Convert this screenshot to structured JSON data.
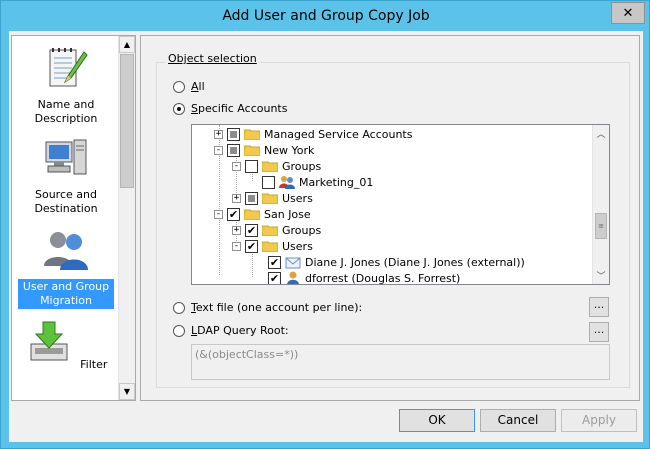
{
  "window": {
    "title": "Add User and Group Copy Job",
    "close_glyph": "✕"
  },
  "nav": {
    "items": [
      {
        "label": "Name and Description",
        "icon": "notepad-pencil-icon",
        "selected": false
      },
      {
        "label": "Source and Destination",
        "icon": "computer-icon",
        "selected": false
      },
      {
        "label": "User and Group Migration",
        "icon": "users-icon",
        "selected": true
      },
      {
        "label": "Filter",
        "icon": "filter-arrow-icon",
        "selected": false
      }
    ]
  },
  "object_selection": {
    "legend": "Object selection",
    "all_label": "All",
    "specific_label": "Specific Accounts",
    "selected_option": "Specific Accounts"
  },
  "tree": {
    "rows": [
      {
        "label": "Managed Service Accounts",
        "state": "partial",
        "expander": "+",
        "icon": "folder-icon"
      },
      {
        "label": "New York",
        "state": "partial",
        "expander": "-",
        "icon": "folder-icon"
      },
      {
        "label": "Groups",
        "state": "unchecked",
        "expander": "-",
        "icon": "folder-icon"
      },
      {
        "label": "Marketing_01",
        "state": "unchecked",
        "expander": "",
        "icon": "group-icon"
      },
      {
        "label": "Users",
        "state": "partial",
        "expander": "+",
        "icon": "folder-icon"
      },
      {
        "label": "San Jose",
        "state": "checked",
        "expander": "-",
        "icon": "folder-icon"
      },
      {
        "label": "Groups",
        "state": "checked",
        "expander": "+",
        "icon": "folder-icon"
      },
      {
        "label": "Users",
        "state": "checked",
        "expander": "-",
        "icon": "folder-icon"
      },
      {
        "label": "Diane J. Jones (Diane J. Jones (external))",
        "state": "checked",
        "expander": "",
        "icon": "contact-icon"
      },
      {
        "label": "dforrest (Douglas S. Forrest)",
        "state": "checked",
        "expander": "",
        "icon": "user-icon"
      }
    ]
  },
  "text_file": {
    "label": "Text file (one account per line):",
    "browse": "..."
  },
  "ldap": {
    "label": "LDAP Query Root:",
    "browse": "...",
    "value": "(&(objectClass=*))"
  },
  "buttons": {
    "ok": "OK",
    "cancel": "Cancel",
    "apply": "Apply"
  }
}
